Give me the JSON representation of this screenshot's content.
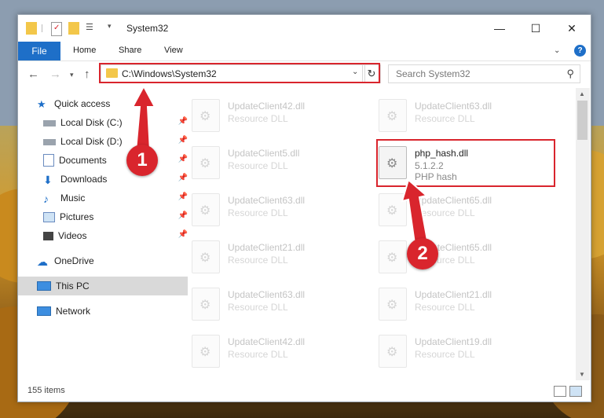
{
  "window": {
    "title": "System32"
  },
  "ribbon": {
    "file": "File",
    "tabs": [
      "Home",
      "Share",
      "View"
    ],
    "help": "?"
  },
  "nav": {
    "address": "C:\\Windows\\System32",
    "search_placeholder": "Search System32"
  },
  "sidebar": {
    "items": [
      {
        "label": "Quick access",
        "icon": "star-icon"
      },
      {
        "label": "Local Disk (C:)",
        "icon": "drive-icon"
      },
      {
        "label": "Local Disk (D:)",
        "icon": "drive-icon"
      },
      {
        "label": "Documents",
        "icon": "documents-icon"
      },
      {
        "label": "Downloads",
        "icon": "downloads-icon"
      },
      {
        "label": "Music",
        "icon": "music-icon"
      },
      {
        "label": "Pictures",
        "icon": "pictures-icon"
      },
      {
        "label": "Videos",
        "icon": "videos-icon"
      },
      {
        "label": "OneDrive",
        "icon": "onedrive-icon"
      },
      {
        "label": "This PC",
        "icon": "pc-icon"
      },
      {
        "label": "Network",
        "icon": "network-icon"
      }
    ]
  },
  "files": [
    {
      "name": "UpdateClient42.dll",
      "type": "Resource DLL"
    },
    {
      "name": "UpdateClient63.dll",
      "type": "Resource DLL"
    },
    {
      "name": "UpdateClient5.dll",
      "type": "Resource DLL"
    },
    {
      "name": "php_hash.dll",
      "version": "5.1.2.2",
      "description": "PHP hash"
    },
    {
      "name": "UpdateClient63.dll",
      "type": "Resource DLL"
    },
    {
      "name": "UpdateClient65.dll",
      "type": "Resource DLL"
    },
    {
      "name": "UpdateClient21.dll",
      "type": "Resource DLL"
    },
    {
      "name": "UpdateClient65.dll",
      "type": "Resource DLL"
    },
    {
      "name": "UpdateClient63.dll",
      "type": "Resource DLL"
    },
    {
      "name": "UpdateClient21.dll",
      "type": "Resource DLL"
    },
    {
      "name": "UpdateClient42.dll",
      "type": "Resource DLL"
    },
    {
      "name": "UpdateClient19.dll",
      "type": "Resource DLL"
    }
  ],
  "status": {
    "count": "155 items"
  },
  "markers": [
    "1",
    "2"
  ],
  "colors": {
    "accent": "#1e6fc8",
    "highlight": "#d9252d"
  }
}
